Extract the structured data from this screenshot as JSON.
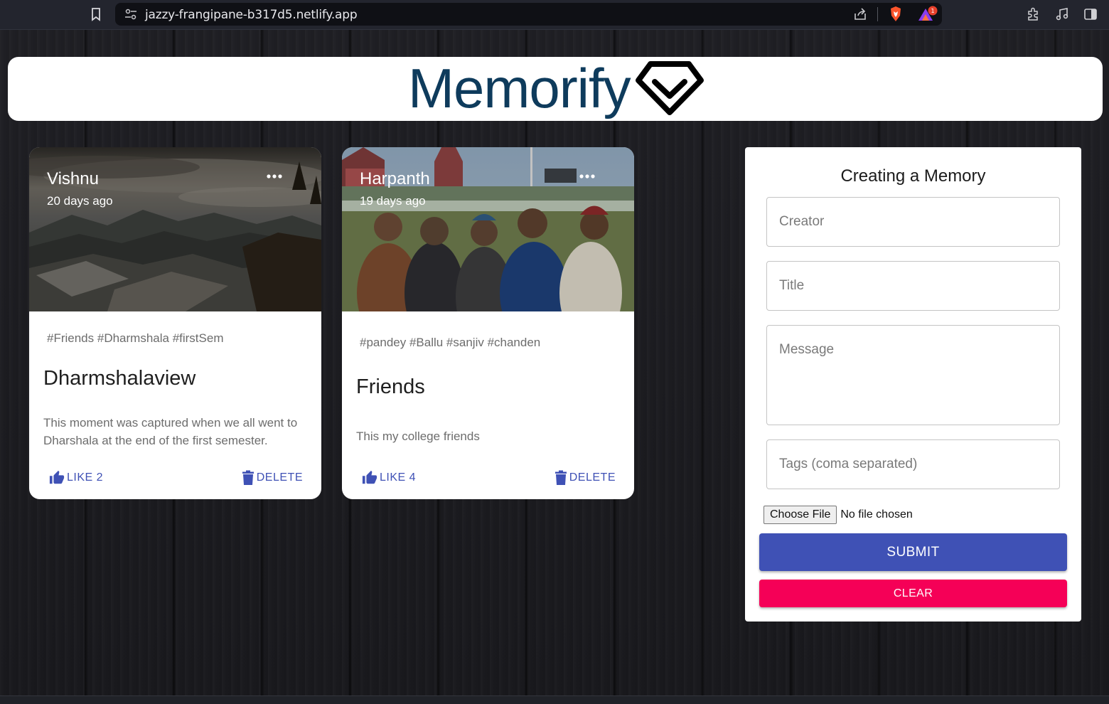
{
  "browser": {
    "url": "jazzy-frangipane-b317d5.netlify.app",
    "badge_count": "1"
  },
  "header": {
    "title": "Memorify",
    "brand_color": "#0e3b5c"
  },
  "posts": [
    {
      "creator": "Vishnu",
      "time_ago": "20 days ago",
      "tags": "#Friends #Dharmshala #firstSem",
      "title": "Dharmshalaview",
      "message": "This moment was captured when we all went to Dharshala at the end of the first semester.",
      "like_label": "LIKE 2",
      "delete_label": "DELETE",
      "image_icon": "mountain-landscape-image"
    },
    {
      "creator": "Harpanth",
      "time_ago": "19 days ago",
      "tags": "#pandey #Ballu #sanjiv #chanden",
      "title": "Friends",
      "message": "This my college friends",
      "like_label": "LIKE 4",
      "delete_label": "DELETE",
      "image_icon": "group-photo-stadium-image"
    }
  ],
  "form": {
    "heading": "Creating a Memory",
    "creator_placeholder": "Creator",
    "title_placeholder": "Title",
    "message_placeholder": "Message",
    "tags_placeholder": "Tags (coma separated)",
    "file_button": "Choose File",
    "file_status": "No file chosen",
    "submit_label": "SUBMIT",
    "clear_label": "CLEAR",
    "primary_color": "#3f51b5",
    "secondary_color": "#f50057"
  }
}
